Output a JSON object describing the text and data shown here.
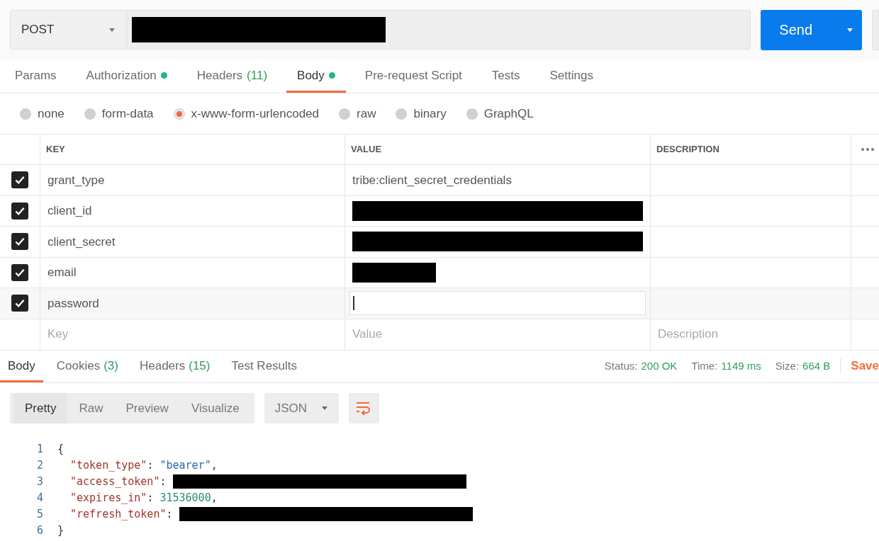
{
  "request": {
    "method": "POST",
    "url": {
      "redacted": true
    },
    "send_label": "Send"
  },
  "request_tabs": [
    {
      "label": "Params",
      "dot": false,
      "selected": false
    },
    {
      "label": "Authorization",
      "dot": true,
      "selected": false
    },
    {
      "label": "Headers",
      "count": "(11)",
      "dot": false,
      "selected": false
    },
    {
      "label": "Body",
      "dot": true,
      "selected": true
    },
    {
      "label": "Pre-request Script",
      "dot": false,
      "selected": false
    },
    {
      "label": "Tests",
      "dot": false,
      "selected": false
    },
    {
      "label": "Settings",
      "dot": false,
      "selected": false
    }
  ],
  "body_types": [
    {
      "label": "none",
      "selected": false
    },
    {
      "label": "form-data",
      "selected": false
    },
    {
      "label": "x-www-form-urlencoded",
      "selected": true
    },
    {
      "label": "raw",
      "selected": false
    },
    {
      "label": "binary",
      "selected": false
    },
    {
      "label": "GraphQL",
      "selected": false
    }
  ],
  "table": {
    "columns": [
      "KEY",
      "VALUE",
      "DESCRIPTION"
    ],
    "rows": [
      {
        "checked": true,
        "key": "grant_type",
        "kind": "text",
        "value": "tribe:client_secret_credentials"
      },
      {
        "checked": true,
        "key": "client_id",
        "kind": "redacted"
      },
      {
        "checked": true,
        "key": "client_secret",
        "kind": "redacted"
      },
      {
        "checked": true,
        "key": "email",
        "kind": "redacted_short"
      },
      {
        "checked": true,
        "key": "password",
        "kind": "input"
      }
    ],
    "new_row": {
      "key_placeholder": "Key",
      "value_placeholder": "Value",
      "description_placeholder": "Description"
    }
  },
  "response_tabs": [
    {
      "label": "Body",
      "selected": true
    },
    {
      "label": "Cookies",
      "count": "(3)",
      "selected": false
    },
    {
      "label": "Headers",
      "count": "(15)",
      "selected": false
    },
    {
      "label": "Test Results",
      "selected": false
    }
  ],
  "response_meta": [
    {
      "label": "Status:",
      "value": "200 OK"
    },
    {
      "label": "Time:",
      "value": "1149 ms"
    },
    {
      "label": "Size:",
      "value": "664 B"
    }
  ],
  "save_link": "Save",
  "view_modes": [
    {
      "label": "Pretty",
      "selected": true
    },
    {
      "label": "Raw",
      "selected": false
    },
    {
      "label": "Preview",
      "selected": false
    },
    {
      "label": "Visualize",
      "selected": false
    }
  ],
  "format": "JSON",
  "code": [
    {
      "number": "1",
      "tokens": [
        {
          "kind": "punct",
          "text": "{"
        }
      ]
    },
    {
      "number": "2",
      "tokens": [
        {
          "kind": "key",
          "text": "\"token_type\""
        },
        {
          "kind": "punct",
          "text": ": "
        },
        {
          "kind": "string",
          "text": "\"bearer\""
        },
        {
          "kind": "punct",
          "text": ","
        }
      ]
    },
    {
      "number": "3",
      "tokens": [
        {
          "kind": "key",
          "text": "\"access_token\""
        },
        {
          "kind": "punct",
          "text": ": "
        },
        {
          "kind": "redacted"
        }
      ]
    },
    {
      "number": "4",
      "tokens": [
        {
          "kind": "key",
          "text": "\"expires_in\""
        },
        {
          "kind": "punct",
          "text": ": "
        },
        {
          "kind": "number",
          "text": "31536000"
        },
        {
          "kind": "punct",
          "text": ","
        }
      ]
    },
    {
      "number": "5",
      "tokens": [
        {
          "kind": "key",
          "text": "\"refresh_token\""
        },
        {
          "kind": "punct",
          "text": ": "
        },
        {
          "kind": "redacted"
        }
      ]
    },
    {
      "number": "6",
      "tokens": [
        {
          "kind": "punct",
          "text": "}"
        }
      ]
    }
  ]
}
